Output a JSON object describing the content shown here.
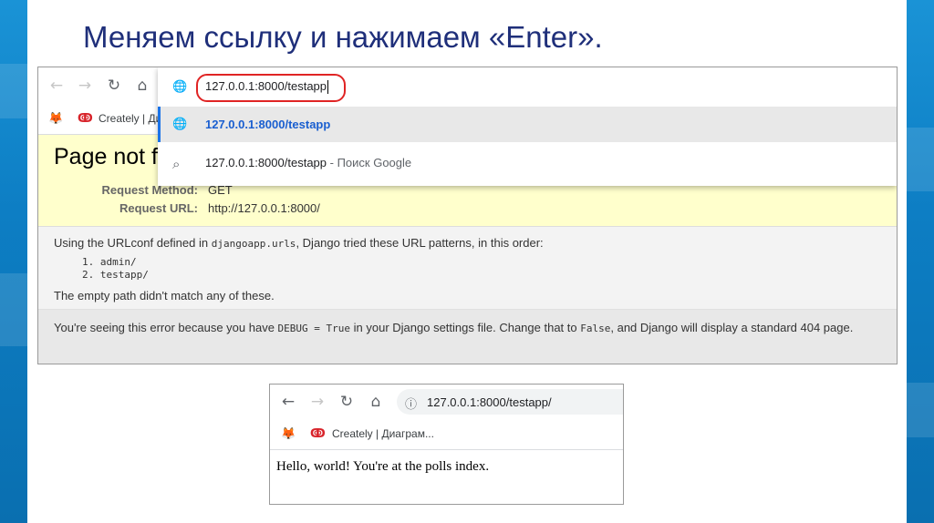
{
  "slide": {
    "title": "Меняем ссылку и нажимаем «Enter»."
  },
  "browser1": {
    "nav": {
      "back_icon": "←",
      "forward_icon": "→",
      "reload_icon": "↻",
      "home_icon": "⌂"
    },
    "address_value": "127.0.0.1:8000/testapp",
    "bookmarks": [
      {
        "icon": "fox-icon",
        "glyph": "🦊",
        "label": ""
      },
      {
        "icon": "creately-icon",
        "glyph": "ↂ",
        "label": "Creately | Диаг"
      }
    ],
    "omnibox": {
      "suggestions": [
        {
          "icon": "globe",
          "glyph": "🌐",
          "text": "127.0.0.1:8000/testapp"
        },
        {
          "icon": "search",
          "glyph": "⌕",
          "text": "127.0.0.1:8000/testapp",
          "suffix": " - Поиск Google"
        }
      ]
    },
    "django": {
      "title": "Page not f",
      "request_method_label": "Request Method:",
      "request_method_value": "GET",
      "request_url_label": "Request URL:",
      "request_url_value": "http://127.0.0.1:8000/",
      "urlconf_prefix": "Using the URLconf defined in ",
      "urlconf_module": "djangoapp.urls",
      "urlconf_suffix": ", Django tried these URL patterns, in this order:",
      "patterns": [
        "1. admin/",
        "2. testapp/"
      ],
      "empty_path_msg": "The empty path didn't match any of these.",
      "debug_prefix": "You're seeing this error because you have ",
      "debug_code": "DEBUG = True",
      "debug_mid": " in your Django settings file. Change that to ",
      "debug_false": "False",
      "debug_suffix": ", and Django will display a standard 404 page."
    }
  },
  "browser2": {
    "address_value": "127.0.0.1:8000/testapp/",
    "bookmarks": [
      {
        "icon": "fox-icon",
        "glyph": "🦊",
        "label": ""
      },
      {
        "icon": "creately-icon",
        "glyph": "ↂ",
        "label": "Creately | Диаграм..."
      }
    ],
    "info_icon": "ⓘ",
    "page_text": "Hello, world! You're at the polls index."
  },
  "colors": {
    "title": "#1f2f7a",
    "side_band": "#0d7ec4",
    "highlight_ring": "#e02424",
    "django_header": "#ffffcc",
    "suggestion_selected": "#e8e8e8",
    "link_blue": "#1a5fd0"
  }
}
